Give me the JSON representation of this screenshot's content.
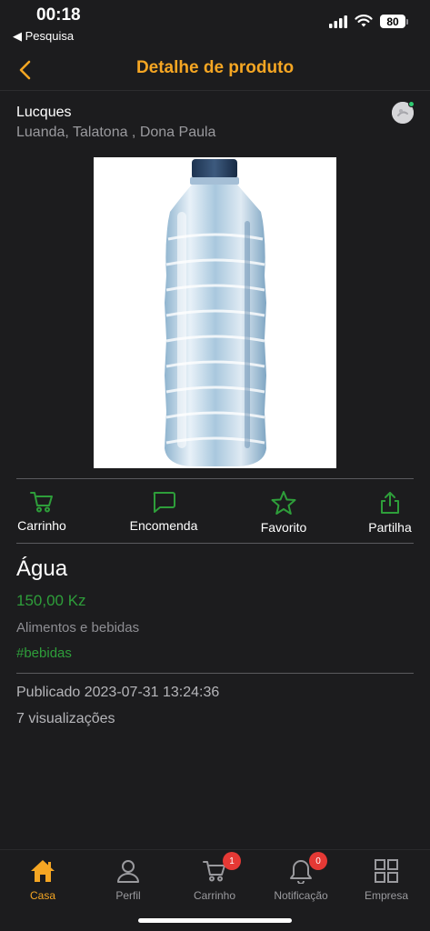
{
  "status_bar": {
    "time": "00:18",
    "back_label": "◀ Pesquisa",
    "battery": "80"
  },
  "nav": {
    "title": "Detalhe de produto",
    "back_icon": "chevron-left-icon",
    "accent_color": "#f5a623"
  },
  "seller": {
    "name": "Lucques",
    "location": "Luanda, Talatona , Dona Paula"
  },
  "product_image": {
    "icon": "water-bottle-image"
  },
  "actions": [
    {
      "label": "Carrinho",
      "icon": "cart-icon"
    },
    {
      "label": "Encomenda",
      "icon": "chat-bubble-icon"
    },
    {
      "label": "Favorito",
      "icon": "star-icon"
    },
    {
      "label": "Partilha",
      "icon": "share-icon"
    }
  ],
  "product": {
    "name": "Água",
    "price": "150,00 Kz",
    "category": "Alimentos e bebidas",
    "tag": "#bebidas",
    "published": "Publicado 2023-07-31 13:24:36",
    "views": "7 visualizações",
    "price_color": "#2e9e3a"
  },
  "tabs": [
    {
      "label": "Casa",
      "icon": "home-icon",
      "active": true
    },
    {
      "label": "Perfil",
      "icon": "person-icon"
    },
    {
      "label": "Carrinho",
      "icon": "cart-icon",
      "badge": "1"
    },
    {
      "label": "Notificação",
      "icon": "bell-icon",
      "badge": "0"
    },
    {
      "label": "Empresa",
      "icon": "grid-icon"
    }
  ]
}
